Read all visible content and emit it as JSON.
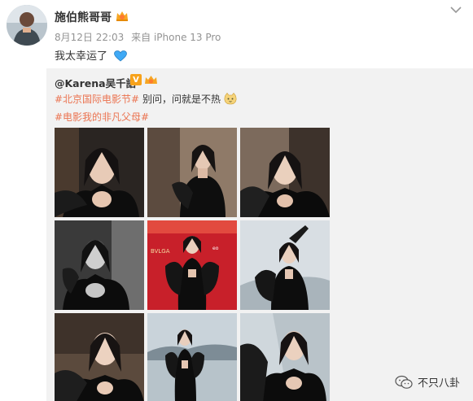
{
  "post": {
    "author": "施伯熊哥哥",
    "date": "8月12日 22:03",
    "source": "来自 iPhone 13 Pro",
    "text": "我太幸运了",
    "icons": {
      "avatar": "user-avatar",
      "badge": "vip-crown-icon",
      "menu": "chevron-down-icon",
      "emoji": "blue-heart-icon"
    }
  },
  "repost": {
    "author": "@Karena吴千語",
    "verified_mark": "V",
    "tag1": "#北京国际电影节#",
    "line2_text": " 别问，问就是不热",
    "tag2": "#电影我的非凡父母#",
    "photos": [
      {
        "scene": "dark-portrait-feather"
      },
      {
        "scene": "dark-standing"
      },
      {
        "scene": "dark-portrait-close"
      },
      {
        "scene": "monochrome-portrait"
      },
      {
        "scene": "red-carpet"
      },
      {
        "scene": "lake-pose-arm"
      },
      {
        "scene": "portrait-soft"
      },
      {
        "scene": "lake-full-body"
      },
      {
        "scene": "lake-portrait"
      }
    ]
  },
  "watermark": {
    "label": "不只八卦",
    "icon": "wechat-icon"
  },
  "colors": {
    "tag": "#eb7350",
    "repost_bg": "#f2f2f2",
    "meta": "#939393"
  }
}
